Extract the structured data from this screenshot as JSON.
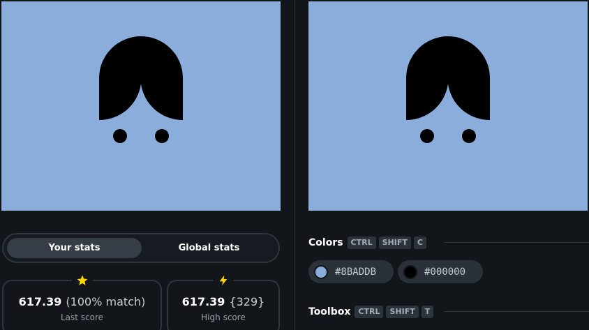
{
  "colors": {
    "background": "#8BADDB",
    "shape": "#000000",
    "accent_yellow": "#FFD400"
  },
  "stats": {
    "tabs": [
      {
        "label": "Your stats",
        "active": true
      },
      {
        "label": "Global stats",
        "active": false
      }
    ],
    "last_score": {
      "icon": "star-icon",
      "score": "617.39",
      "extra": "(100% match)",
      "label": "Last score"
    },
    "high_score": {
      "icon": "lightning-icon",
      "score": "617.39",
      "extra": "{329}",
      "label": "High score"
    }
  },
  "panel": {
    "colors": {
      "title": "Colors",
      "shortcut": [
        "CTRL",
        "SHIFT",
        "C"
      ],
      "swatches": [
        {
          "hex": "#8BADDB",
          "label": "#8BADDB"
        },
        {
          "hex": "#000000",
          "label": "#000000"
        }
      ]
    },
    "toolbox": {
      "title": "Toolbox",
      "shortcut": [
        "CTRL",
        "SHIFT",
        "T"
      ]
    }
  }
}
